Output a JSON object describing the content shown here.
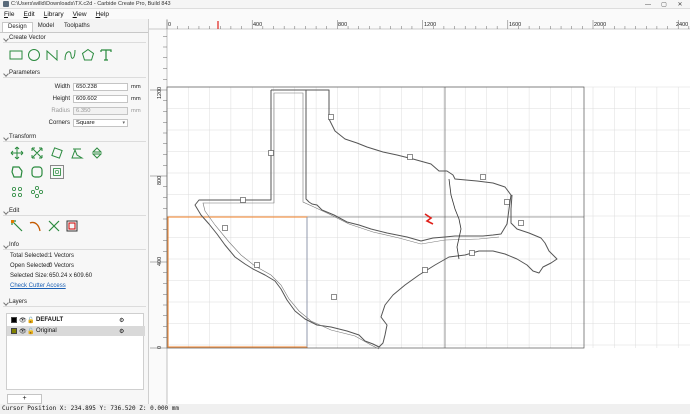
{
  "window": {
    "title": "C:\\Users\\willd\\Downloads\\TX.c2d - Carbide Create Pro, Build 843",
    "controls": [
      "—",
      "▢",
      "✕"
    ]
  },
  "menu": [
    "File",
    "Edit",
    "Library",
    "View",
    "Help"
  ],
  "tabs": [
    "Design",
    "Model",
    "Toolpaths"
  ],
  "sections": {
    "create_vector": "Create Vector",
    "parameters": "Parameters",
    "transform": "Transform",
    "edit": "Edit",
    "info": "Info",
    "layers": "Layers"
  },
  "parameters": {
    "width_label": "Width",
    "width_value": "650.238",
    "width_unit": "mm",
    "height_label": "Height",
    "height_value": "609.602",
    "height_unit": "mm",
    "radius_label": "Radius",
    "radius_value": "6.350",
    "radius_unit": "mm",
    "corners_label": "Corners",
    "corners_value": "Square"
  },
  "info": {
    "total_selected_label": "Total Selected:",
    "total_selected_value": "1 Vectors",
    "open_selected_label": "Open Selected:",
    "open_selected_value": "0 Vectors",
    "selected_size_label": "Selected Size:",
    "selected_size_value": "650.24 x 609.60",
    "check_cutter_link": "Check Cutter Access"
  },
  "layers": [
    {
      "name": "DEFAULT",
      "color": "#000000",
      "bold": true
    },
    {
      "name": "Original",
      "color": "#808000",
      "bold": false,
      "selected": true
    }
  ],
  "add_layer_label": "+",
  "status": "Cursor Position X: 234.895 Y: 736.520 Z: 0.000 mm",
  "ruler": {
    "x_ticks": [
      "0",
      "400",
      "800",
      "1200",
      "1600",
      "2000",
      "2400"
    ],
    "y_ticks": [
      "1200",
      "800",
      "400",
      "0"
    ]
  },
  "colors": {
    "accent": "#1f7a3a",
    "icon_green": "#2a8a3e",
    "selection_orange": "#ef7d22",
    "cursor_marker": "#e0201a",
    "grid": "#dcdcdc"
  }
}
